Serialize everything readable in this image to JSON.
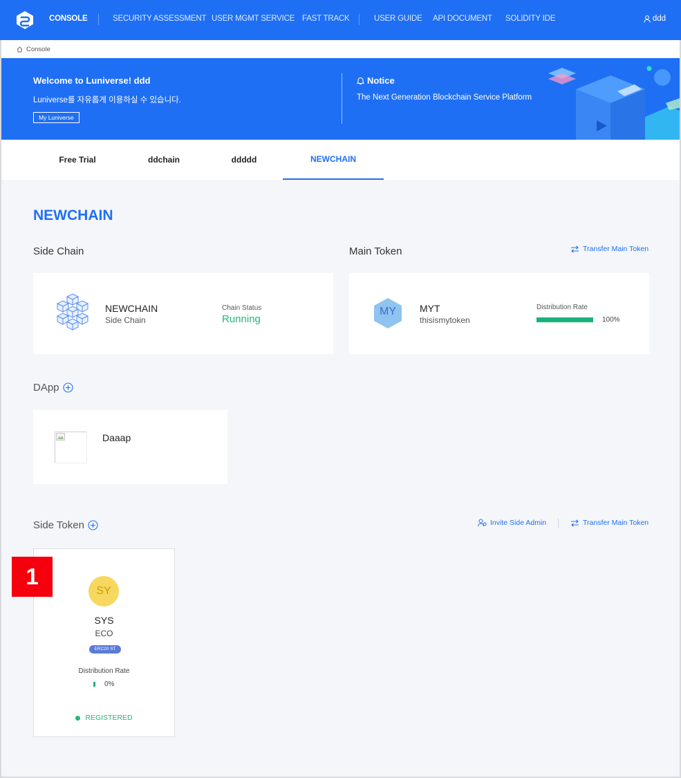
{
  "nav": {
    "items": [
      {
        "label": "CONSOLE",
        "active": true
      },
      {
        "label": "SECURITY ASSESSMENT"
      },
      {
        "label": "USER MGMT SERVICE"
      },
      {
        "label": "FAST TRACK"
      },
      {
        "label": "USER GUIDE"
      },
      {
        "label": "API DOCUMENT"
      },
      {
        "label": "SOLIDITY IDE"
      }
    ],
    "user": "ddd"
  },
  "breadcrumb": {
    "label": "Console",
    "icon": "home-icon"
  },
  "banner": {
    "welcome_title": "Welcome to Luniverse! ddd",
    "welcome_sub": "Luniverse를 자유롭게 이용하실 수 있습니다.",
    "button_label": "My Luniverse",
    "notice_title": "Notice",
    "notice_text": "The Next Generation Blockchain Service Platform"
  },
  "tabs": [
    {
      "label": "Free Trial"
    },
    {
      "label": "ddchain"
    },
    {
      "label": "ddddd"
    },
    {
      "label": "NEWCHAIN",
      "active": true
    }
  ],
  "page": {
    "title": "NEWCHAIN"
  },
  "side_chain": {
    "section_label": "Side Chain",
    "name": "NEWCHAIN",
    "type": "Side Chain",
    "status_label": "Chain Status",
    "status_value": "Running"
  },
  "main_token": {
    "section_label": "Main Token",
    "action_label": "Transfer Main Token",
    "symbol_short": "MY",
    "symbol": "MYT",
    "name": "thisismytoken",
    "rate_label": "Distribution Rate",
    "rate_value": "100%",
    "rate_fraction": 1.0
  },
  "dapp": {
    "section_label": "DApp",
    "items": [
      {
        "name": "Daaap"
      }
    ]
  },
  "side_token": {
    "section_label": "Side Token",
    "invite_label": "Invite Side Admin",
    "transfer_label": "Transfer Main Token",
    "annotation_number": "1",
    "tokens": [
      {
        "symbol_short": "SY",
        "symbol": "SYS",
        "name": "ECO",
        "standard": "ERC20 ST",
        "rate_label": "Distribution Rate",
        "rate_value": "0%",
        "rate_fraction": 0.0,
        "status": "REGISTERED"
      }
    ]
  },
  "colors": {
    "primary": "#1f6ff5",
    "success": "#1fb877",
    "annotation": "#f5000c",
    "token_yellow": "#f6d860"
  }
}
